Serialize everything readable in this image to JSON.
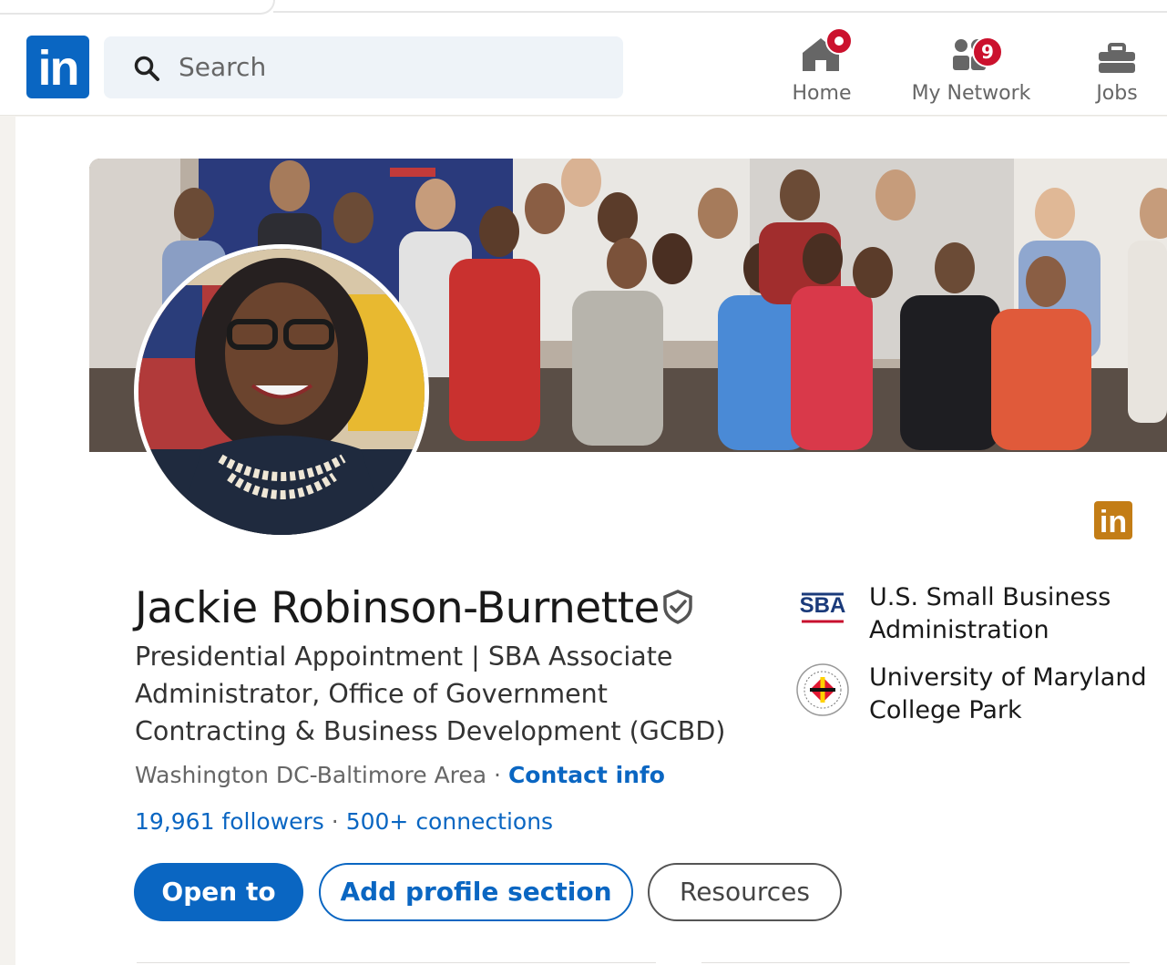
{
  "nav": {
    "search_placeholder": "Search",
    "items": [
      {
        "label": "Home",
        "badge": ""
      },
      {
        "label": "My Network",
        "badge": "9"
      },
      {
        "label": "Jobs",
        "badge": ""
      }
    ]
  },
  "profile": {
    "name": "Jackie Robinson-Burnette",
    "headline": "Presidential Appointment | SBA Associate Administrator, Office of Government Contracting & Business Development (GCBD)",
    "location": "Washington DC-Baltimore Area",
    "location_sep": " · ",
    "contact_info": "Contact info",
    "followers": "19,961 followers",
    "connections": "500+ connections",
    "stats_sep": " · "
  },
  "actions": {
    "open_to": "Open to",
    "add_section": "Add profile section",
    "resources": "Resources"
  },
  "orgs": [
    {
      "name": "U.S. Small Business Administration",
      "logo": "SBA"
    },
    {
      "name": "University of Maryland College Park",
      "logo": "university-seal"
    }
  ],
  "colors": {
    "brand": "#0a66c2",
    "badge": "#cb112d",
    "premium_badge": "#c37d16"
  }
}
